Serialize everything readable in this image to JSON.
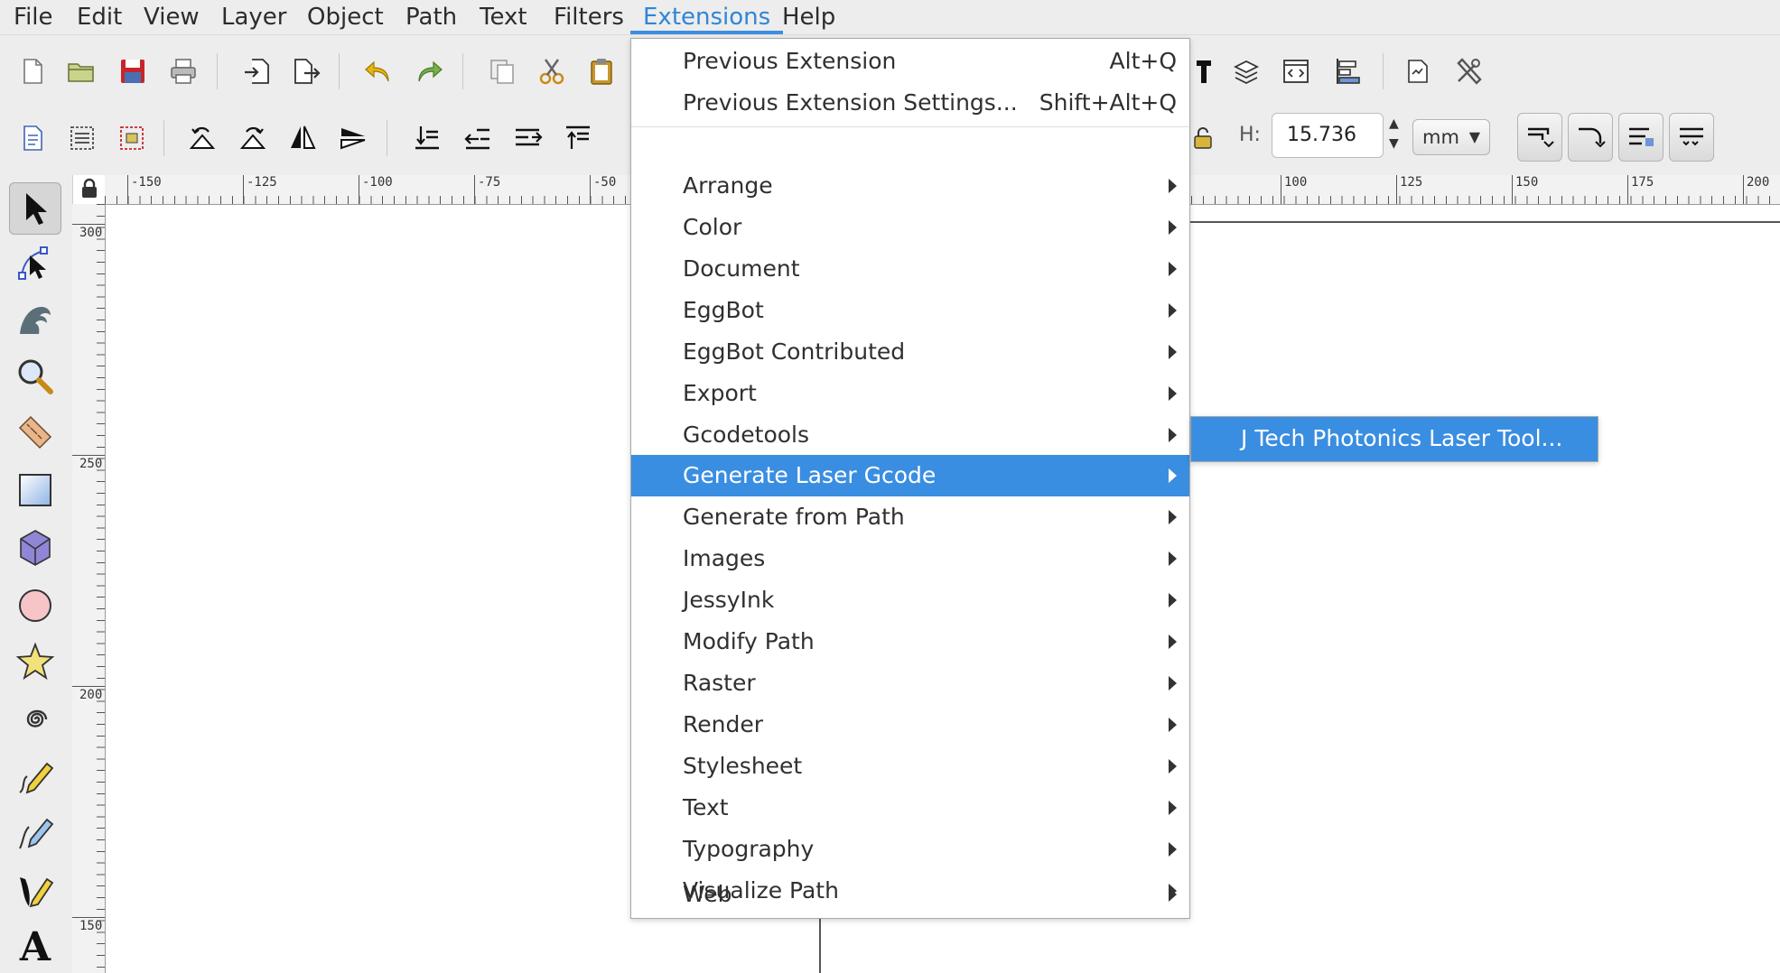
{
  "menubar": {
    "items": [
      {
        "label": "File"
      },
      {
        "label": "Edit"
      },
      {
        "label": "View"
      },
      {
        "label": "Layer"
      },
      {
        "label": "Object"
      },
      {
        "label": "Path"
      },
      {
        "label": "Text"
      },
      {
        "label": "Filters"
      },
      {
        "label": "Extensions"
      },
      {
        "label": "Help"
      }
    ],
    "active": "Extensions"
  },
  "toolbar": {
    "height_label": "H:",
    "height_value": "15.736",
    "unit": "mm"
  },
  "rulers": {
    "horizontal_ticks": [
      "-150",
      "-125",
      "-100",
      "-75",
      "-50",
      "100",
      "125",
      "150",
      "175",
      "200"
    ],
    "vertical_ticks": [
      "300",
      "250",
      "200",
      "150"
    ]
  },
  "extensions_menu": {
    "top_items": [
      {
        "label": "Previous Extension",
        "shortcut": "Alt+Q"
      },
      {
        "label": "Previous Extension Settings...",
        "shortcut": "Shift+Alt+Q"
      }
    ],
    "submenus": [
      {
        "label": "Arrange"
      },
      {
        "label": "Color"
      },
      {
        "label": "Document"
      },
      {
        "label": "EggBot"
      },
      {
        "label": "EggBot Contributed"
      },
      {
        "label": "Export"
      },
      {
        "label": "Gcodetools"
      },
      {
        "label": "Generate Laser Gcode"
      },
      {
        "label": "Generate from Path"
      },
      {
        "label": "Images"
      },
      {
        "label": "JessyInk"
      },
      {
        "label": "Modify Path"
      },
      {
        "label": "Raster"
      },
      {
        "label": "Render"
      },
      {
        "label": "Stylesheet"
      },
      {
        "label": "Text"
      },
      {
        "label": "Typography"
      },
      {
        "label": "Visualize Path"
      },
      {
        "label": "Web"
      }
    ],
    "highlighted": "Generate Laser Gcode"
  },
  "laser_submenu": {
    "items": [
      {
        "label": "J Tech Photonics Laser Tool..."
      }
    ]
  },
  "icons": {
    "file_toolbar": [
      "new-document-icon",
      "open-folder-icon",
      "save-icon",
      "print-icon",
      "import-icon",
      "export-icon",
      "undo-icon",
      "redo-icon",
      "copy-icon",
      "cut-icon",
      "paste-icon"
    ],
    "right_toolbar": [
      "text-tool-icon",
      "layers-icon",
      "xml-editor-icon",
      "align-icon",
      "document-properties-icon",
      "preferences-icon"
    ],
    "transform_toolbar": [
      "select-all-icon",
      "select-all-layers-icon",
      "deselect-icon",
      "rotate-ccw-icon",
      "rotate-cw-icon",
      "flip-horizontal-icon",
      "flip-vertical-icon",
      "lower-to-bottom-icon",
      "lower-icon",
      "raise-icon",
      "raise-to-top-icon"
    ],
    "tools": [
      "selector-tool-icon",
      "node-tool-icon",
      "tweak-tool-icon",
      "zoom-tool-icon",
      "measure-tool-icon",
      "rectangle-tool-icon",
      "3d-box-tool-icon",
      "ellipse-tool-icon",
      "star-tool-icon",
      "spiral-tool-icon",
      "pencil-tool-icon",
      "pen-tool-icon",
      "calligraphy-tool-icon",
      "text-tool-icon"
    ]
  },
  "colors": {
    "menu_highlight": "#3a8ee1",
    "active_menu_text": "#2f86d6",
    "toolbar_bg": "#ededed"
  }
}
